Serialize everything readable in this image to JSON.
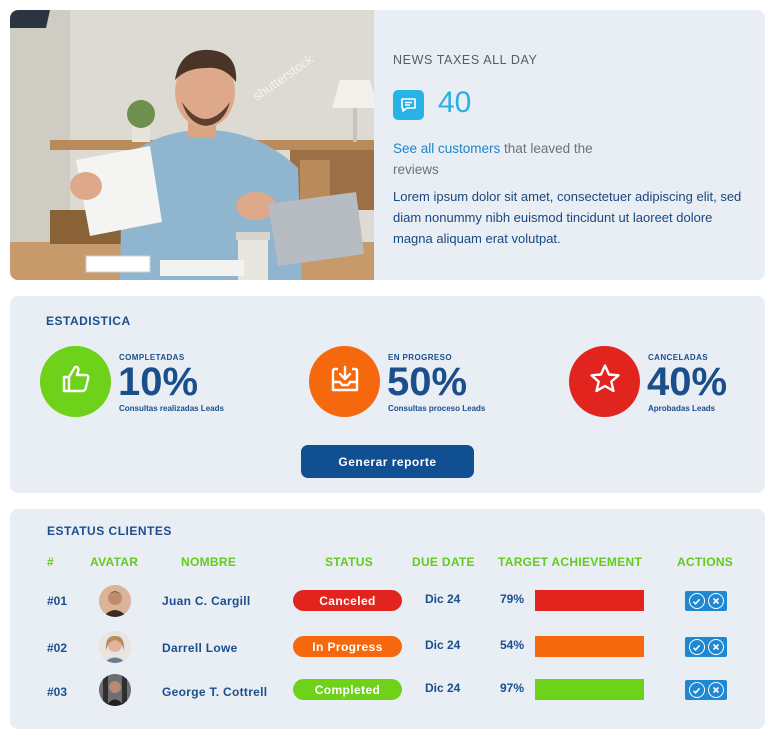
{
  "news": {
    "title": "NEWS TAXES ALL DAY",
    "count": "40",
    "link_text": "See all customers",
    "reviews_text": " that leaved the reviews",
    "description": "Lorem ipsum dolor sit amet, consectetuer adipiscing elit, sed diam nonummy nibh euismod tincidunt ut laoreet dolore magna aliquam erat volutpat.",
    "watermark": "shutterstock"
  },
  "stats": {
    "title": "ESTADISTICA",
    "items": [
      {
        "label": "COMPLETADAS",
        "value": "10%",
        "sub": "Consultas realizadas Leads",
        "color": "#6ed11a",
        "icon": "thumbs-up-icon"
      },
      {
        "label": "EN PROGRESO",
        "value": "50%",
        "sub": "Consultas proceso Leads",
        "color": "#f5680d",
        "icon": "inbox-download-icon"
      },
      {
        "label": "CANCELADAS",
        "value": "40%",
        "sub": "Aprobadas Leads",
        "color": "#e2241f",
        "icon": "star-icon"
      }
    ],
    "button_label": "Generar reporte"
  },
  "clients": {
    "title": "ESTATUS CLIENTES",
    "headers": {
      "num": "#",
      "avatar": "AVATAR",
      "name": "NOMBRE",
      "status": "STATUS",
      "due": "DUE DATE",
      "target": "TARGET ACHIEVEMENT",
      "actions": "ACTIONS"
    },
    "rows": [
      {
        "num": "#01",
        "name": "Juan C. Cargill",
        "status": "Canceled",
        "status_color": "#e2241f",
        "due": "Dic 24",
        "target": "79%",
        "target_fraction": 1.0,
        "bar_color": "#e2241f"
      },
      {
        "num": "#02",
        "name": "Darrell Lowe",
        "status": "In Progress",
        "status_color": "#f5680d",
        "due": "Dic 24",
        "target": "54%",
        "target_fraction": 1.0,
        "bar_color": "#f5680d"
      },
      {
        "num": "#03",
        "name": "George T. Cottrell",
        "status": "Completed",
        "status_color": "#6ed11a",
        "due": "Dic 24",
        "target": "97%",
        "target_fraction": 1.0,
        "bar_color": "#6ed11a"
      }
    ]
  }
}
